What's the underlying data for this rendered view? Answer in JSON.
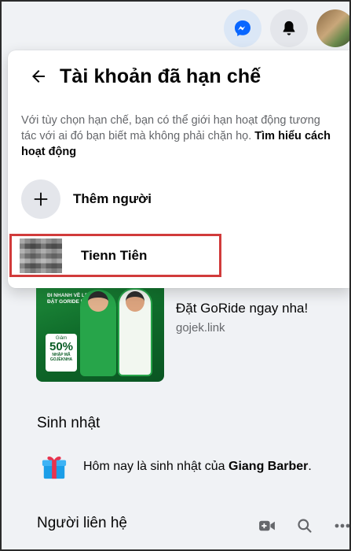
{
  "panel": {
    "title": "Tài khoản đã hạn chế",
    "description": "Với tùy chọn hạn chế, bạn có thể giới hạn hoạt động tương tác với ai đó bạn biết mà không phải chặn họ.",
    "learn_more": "Tìm hiểu cách hoạt động",
    "add_label": "Thêm người",
    "restricted_users": [
      {
        "name": "Tienn Tiên"
      }
    ]
  },
  "ad": {
    "title": "Đặt GoRide ngay nha!",
    "link": "gojek.link",
    "image_text": {
      "banner": "ĐI NHANH VỀ LẸ ĐẶT GORIDE NHA",
      "badge_top": "Giảm",
      "badge_value": "50%",
      "badge_bottom": "NHẬP MÃ GOJEKNHA"
    }
  },
  "birthdays": {
    "title": "Sinh nhật",
    "text_prefix": "Hôm nay là sinh nhật của ",
    "person": "Giang Barber",
    "text_suffix": "."
  },
  "contacts": {
    "title": "Người liên hệ"
  },
  "colors": {
    "accent": "#0866ff",
    "highlight_border": "#d13b3b",
    "gojek_green": "#1e8a3a"
  },
  "icons": [
    "messenger-icon",
    "bell-icon",
    "back-arrow-icon",
    "plus-icon",
    "gift-icon",
    "video-add-icon",
    "search-icon",
    "more-icon"
  ]
}
